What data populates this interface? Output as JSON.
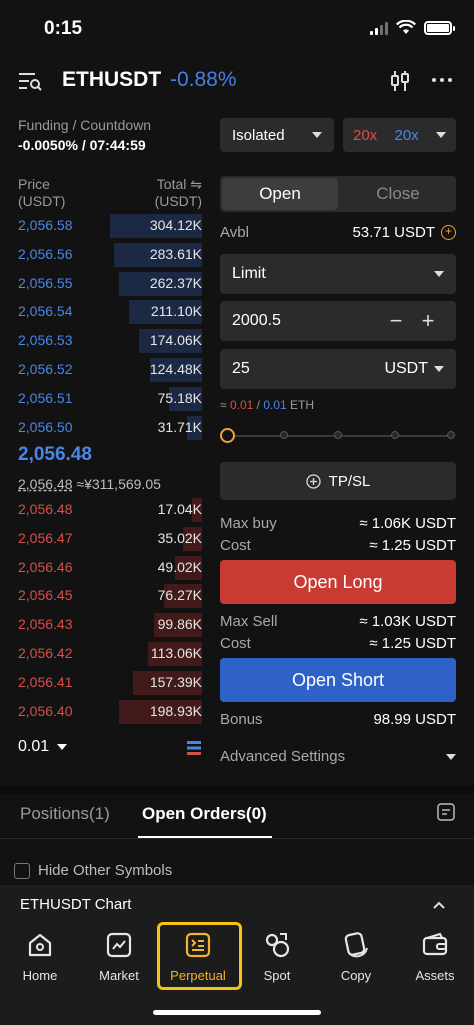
{
  "status": {
    "time": "0:15"
  },
  "header": {
    "pair": "ETHUSDT",
    "change": "-0.88%"
  },
  "funding": {
    "label": "Funding / Countdown",
    "value": "-0.0050% / 07:44:59"
  },
  "controls": {
    "margin_mode": "Isolated",
    "leverage_long": "20x",
    "leverage_short": "20x"
  },
  "orderbook": {
    "price_header": "Price",
    "price_unit": "(USDT)",
    "total_header": "Total ⇋",
    "total_unit": "(USDT)",
    "asks": [
      {
        "price": "2,056.58",
        "qty": "304.12K",
        "depth": 0.48
      },
      {
        "price": "2,056.56",
        "qty": "283.61K",
        "depth": 0.46
      },
      {
        "price": "2,056.55",
        "qty": "262.37K",
        "depth": 0.43
      },
      {
        "price": "2,056.54",
        "qty": "211.10K",
        "depth": 0.38
      },
      {
        "price": "2,056.53",
        "qty": "174.06K",
        "depth": 0.33
      },
      {
        "price": "2,056.52",
        "qty": "124.48K",
        "depth": 0.27
      },
      {
        "price": "2,056.51",
        "qty": "75.18K",
        "depth": 0.17
      },
      {
        "price": "2,056.50",
        "qty": "31.71K",
        "depth": 0.08
      }
    ],
    "mid_price": "2,056.48",
    "mark_price": "2,056.48",
    "mark_fiat": "≈¥311,569.05",
    "bids": [
      {
        "price": "2,056.48",
        "qty": "17.04K",
        "depth": 0.05
      },
      {
        "price": "2,056.47",
        "qty": "35.02K",
        "depth": 0.1
      },
      {
        "price": "2,056.46",
        "qty": "49.02K",
        "depth": 0.14
      },
      {
        "price": "2,056.45",
        "qty": "76.27K",
        "depth": 0.2
      },
      {
        "price": "2,056.43",
        "qty": "99.86K",
        "depth": 0.25
      },
      {
        "price": "2,056.42",
        "qty": "113.06K",
        "depth": 0.28
      },
      {
        "price": "2,056.41",
        "qty": "157.39K",
        "depth": 0.36
      },
      {
        "price": "2,056.40",
        "qty": "198.93K",
        "depth": 0.43
      }
    ],
    "depth": "0.01"
  },
  "order": {
    "tab_open": "Open",
    "tab_close": "Close",
    "avbl_label": "Avbl",
    "avbl_value": "53.71 USDT",
    "order_type": "Limit",
    "price": "2000.5",
    "amount": "25",
    "amount_unit": "USDT",
    "approx_prefix": "≈",
    "approx_red": "0.01",
    "approx_sep": "/",
    "approx_blue": "0.01",
    "approx_unit": "ETH",
    "tpsl": "TP/SL",
    "max_buy_label": "Max buy",
    "max_buy_value": "≈ 1.06K USDT",
    "cost_label": "Cost",
    "cost_long_value": "≈ 1.25 USDT",
    "open_long": "Open Long",
    "max_sell_label": "Max Sell",
    "max_sell_value": "≈ 1.03K USDT",
    "cost_short_value": "≈ 1.25 USDT",
    "open_short": "Open Short",
    "bonus_label": "Bonus",
    "bonus_value": "98.99 USDT",
    "advanced": "Advanced Settings"
  },
  "tabs": {
    "positions": "Positions(1)",
    "open_orders": "Open Orders(0)"
  },
  "filters": {
    "hide_other": "Hide Other Symbols"
  },
  "chart": {
    "title": "ETHUSDT Chart"
  },
  "nav": [
    {
      "label": "Home"
    },
    {
      "label": "Market"
    },
    {
      "label": "Perpetual"
    },
    {
      "label": "Spot"
    },
    {
      "label": "Copy"
    },
    {
      "label": "Assets"
    }
  ],
  "colors": {
    "accent": "#f0b429",
    "long": "#c93a33",
    "short": "#2f62c8",
    "ask": "#4a86e8",
    "bid": "#d6504a"
  }
}
